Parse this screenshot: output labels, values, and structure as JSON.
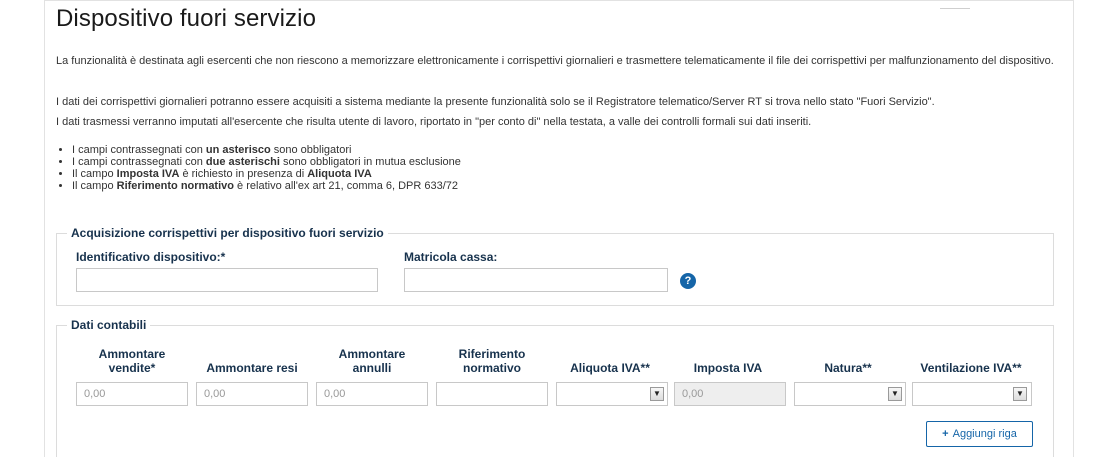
{
  "page": {
    "title": "Dispositivo fuori servizio",
    "intro_1": "La funzionalità è destinata agli esercenti che non riescono a memorizzare elettronicamente i corrispettivi giornalieri e trasmettere telematicamente il file dei corrispettivi per malfunzionamento del dispositivo.",
    "intro_2": "I dati dei corrispettivi giornalieri potranno essere acquisiti a sistema mediante la presente funzionalità solo se il Registratore telematico/Server RT si trova nello stato \"Fuori Servizio\".",
    "intro_3": "I dati trasmessi verranno imputati all'esercente che risulta utente di lavoro, riportato in \"per conto di\" nella testata, a valle dei controlli formali sui dati inseriti."
  },
  "rules": [
    {
      "pre": "I campi contrassegnati con ",
      "bold": "un asterisco",
      "post": " sono obbligatori",
      "bold2": "",
      "post2": ""
    },
    {
      "pre": "I campi contrassegnati con ",
      "bold": "due asterischi",
      "post": " sono obbligatori in mutua esclusione",
      "bold2": "",
      "post2": ""
    },
    {
      "pre": "Il campo ",
      "bold": "Imposta IVA",
      "post": " è richiesto in presenza di ",
      "bold2": "Aliquota IVA",
      "post2": ""
    },
    {
      "pre": "Il campo ",
      "bold": "Riferimento normativo",
      "post": " è relativo all'ex art 21, comma 6, DPR 633/72",
      "bold2": "",
      "post2": ""
    }
  ],
  "acquisizione": {
    "legend": "Acquisizione corrispettivi per dispositivo fuori servizio",
    "id_label": "Identificativo dispositivo:*",
    "id_value": "",
    "matricola_label": "Matricola cassa:",
    "matricola_value": "",
    "help_icon": "question-circle-icon",
    "help_glyph": "?"
  },
  "dati": {
    "legend": "Dati contabili",
    "columns": {
      "vendite_1": "Ammontare",
      "vendite_2": "vendite*",
      "resi": "Ammontare resi",
      "annulli_1": "Ammontare",
      "annulli_2": "annulli",
      "rif_1": "Riferimento",
      "rif_2": "normativo",
      "aliquota": "Aliquota IVA**",
      "imposta": "Imposta IVA",
      "natura": "Natura**",
      "ventilazione": "Ventilazione IVA**"
    },
    "row": {
      "vendite": "0,00",
      "resi": "0,00",
      "annulli": "0,00",
      "rif": "",
      "aliquota": "",
      "imposta": "0,00",
      "natura": "",
      "ventilazione": ""
    },
    "dropdown_glyph": "▼",
    "add_plus": "+",
    "add_label": "Aggiungi riga"
  }
}
